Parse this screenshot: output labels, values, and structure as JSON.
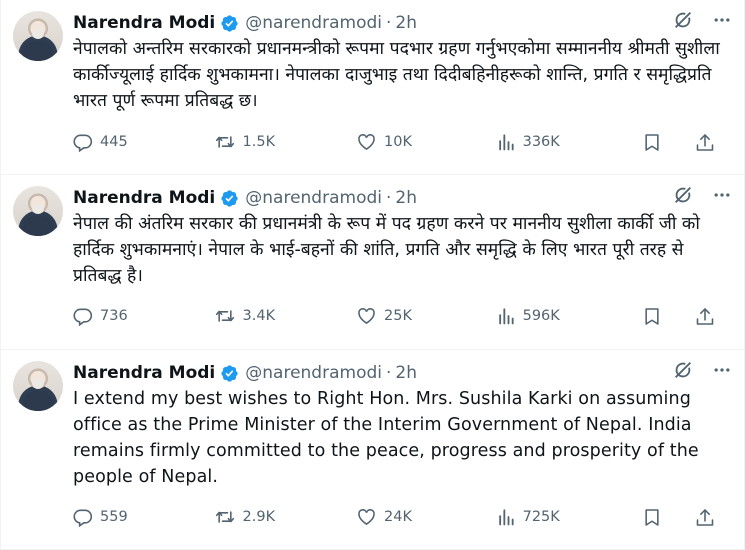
{
  "tweets": [
    {
      "author": "Narendra Modi",
      "handle": "@narendramodi",
      "time": "2h",
      "text": "नेपालको अन्तरिम सरकारको प्रधानमन्त्रीको रूपमा पदभार ग्रहण गर्नुभएकोमा सम्माननीय श्रीमती सुशीला कार्कीज्यूलाई हार्दिक शुभकामना। नेपालका दाजुभाइ तथा दिदीबहिनीहरूको शान्ति, प्रगति र समृद्धिप्रति भारत पूर्ण रूपमा प्रतिबद्ध छ।",
      "replies": "445",
      "reposts": "1.5K",
      "likes": "10K",
      "views": "336K"
    },
    {
      "author": "Narendra Modi",
      "handle": "@narendramodi",
      "time": "2h",
      "text": "नेपाल की अंतरिम सरकार की प्रधानमंत्री के रूप में पद ग्रहण करने पर माननीय सुशीला कार्की जी को हार्दिक शुभकामनाएं। नेपाल के भाई-बहनों की शांति, प्रगति और समृद्धि के लिए भारत पूरी तरह से प्रतिबद्ध है।",
      "replies": "736",
      "reposts": "3.4K",
      "likes": "25K",
      "views": "596K"
    },
    {
      "author": "Narendra Modi",
      "handle": "@narendramodi",
      "time": "2h",
      "text": "I extend my best wishes to Right Hon. Mrs. Sushila Karki on assuming office as the Prime Minister of the Interim Government of Nepal. India remains firmly committed to the peace, progress and prosperity of the people of Nepal.",
      "replies": "559",
      "reposts": "2.9K",
      "likes": "24K",
      "views": "725K"
    }
  ],
  "colors": {
    "text": "#0f1419",
    "muted": "#536471",
    "verified": "#1d9bf0",
    "divider": "#eff3f4"
  },
  "icons": [
    "verified-badge-icon",
    "grok-icon",
    "more-icon",
    "reply-icon",
    "repost-icon",
    "like-icon",
    "views-icon",
    "bookmark-icon",
    "share-icon"
  ]
}
